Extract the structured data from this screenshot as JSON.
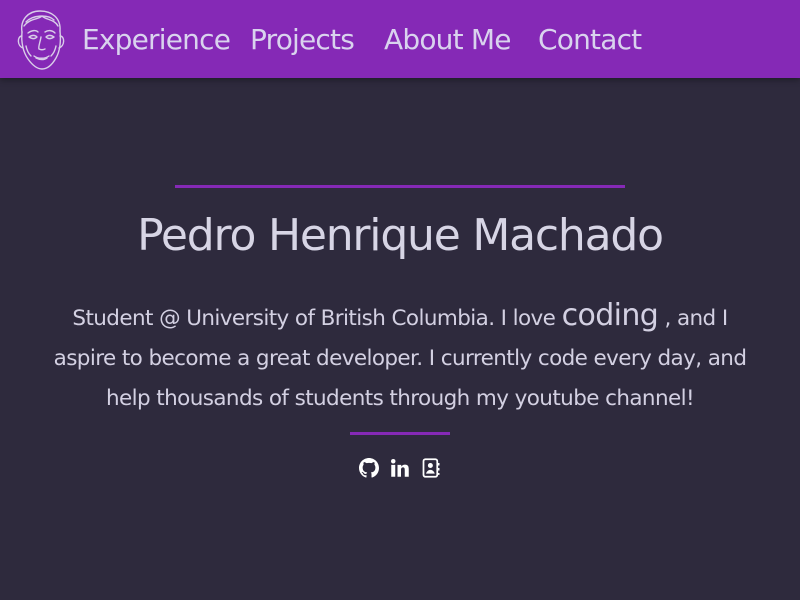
{
  "nav": {
    "links": [
      {
        "label": "Experience"
      },
      {
        "label": "Projects"
      },
      {
        "label": "About Me"
      },
      {
        "label": "Contact"
      }
    ],
    "logo_icon": "face-sketch-logo",
    "background_color": "#8529b6"
  },
  "hero": {
    "name": "Pedro Henrique Machado",
    "bio": {
      "before": "Student @ University of British Columbia. I love ",
      "highlight": "coding",
      "after": " , and I aspire to become a great developer. I currently code every day, and help thousands of students through my youtube channel!"
    },
    "accent_color": "#8529b6",
    "background_color": "#2e2a3d"
  },
  "socials": [
    {
      "icon": "github-icon"
    },
    {
      "icon": "linkedin-icon"
    },
    {
      "icon": "contact-card-icon"
    }
  ]
}
